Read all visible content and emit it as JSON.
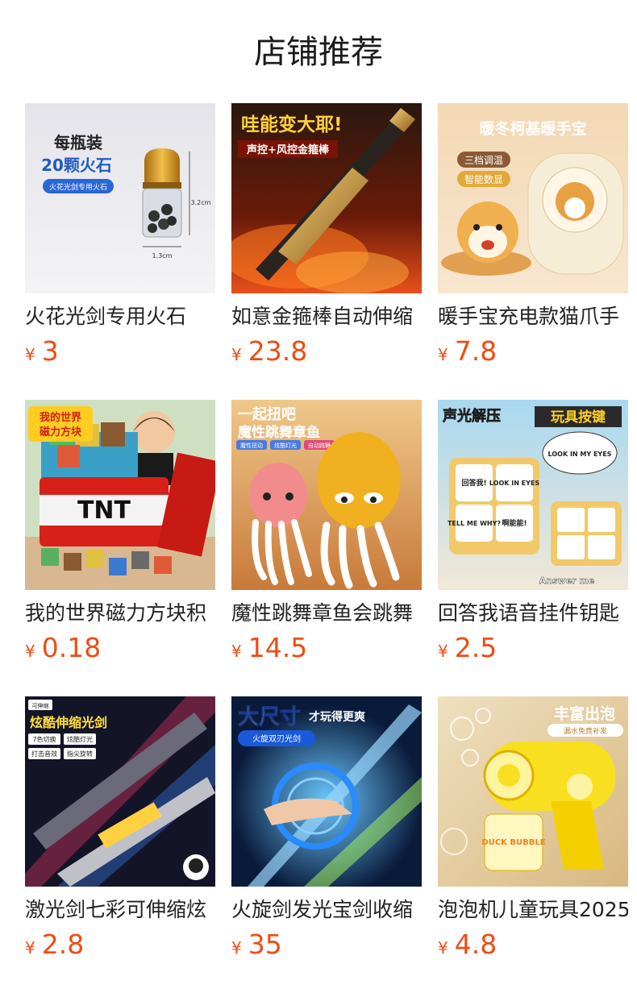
{
  "page": {
    "title": "店铺推荐"
  },
  "products": [
    {
      "name": "火花光剑专用火石",
      "currency": "¥",
      "price": "3",
      "thumb_texts": [
        "每瓶装",
        "20颗火石",
        "火花光剑专用火石",
        "3.2cm",
        "1.3cm"
      ]
    },
    {
      "name": "如意金箍棒自动伸缩",
      "currency": "¥",
      "price": "23.8",
      "thumb_texts": [
        "哇能变大耶!",
        "声控+风控金箍棒"
      ]
    },
    {
      "name": "暖手宝充电款猫爪手",
      "currency": "¥",
      "price": "7.8",
      "thumb_texts": [
        "暖冬柯基暖手宝",
        "三档调温",
        "智能数显"
      ]
    },
    {
      "name": "我的世界磁力方块积",
      "currency": "¥",
      "price": "0.18",
      "thumb_texts": [
        "我的世界",
        "磁力方块",
        "TNT"
      ]
    },
    {
      "name": "魔性跳舞章鱼会跳舞",
      "currency": "¥",
      "price": "14.5",
      "thumb_texts": [
        "一起扭吧",
        "魔性跳舞章鱼",
        "魔性扭动",
        "炫酷灯光",
        "自动跳舞"
      ]
    },
    {
      "name": "回答我语音挂件钥匙",
      "currency": "¥",
      "price": "2.5",
      "thumb_texts": [
        "声光解压",
        "玩具按键",
        "LOOK IN MY EYES",
        "回答我!",
        "LOOK IN EYES",
        "TELL ME WHY?",
        "啊能能!",
        "Answer me"
      ]
    },
    {
      "name": "激光剑七彩可伸缩炫",
      "currency": "¥",
      "price": "2.8",
      "thumb_texts": [
        "可伸缩",
        "炫酷伸缩光剑",
        "7色切换",
        "炫酷灯光",
        "打击音效",
        "指尖旋转"
      ]
    },
    {
      "name": "火旋剑发光宝剑收缩",
      "currency": "¥",
      "price": "35",
      "thumb_texts": [
        "大尺寸",
        "才玩得更爽",
        "火旋双刃光剑"
      ]
    },
    {
      "name": "泡泡机儿童玩具2025",
      "currency": "¥",
      "price": "4.8",
      "thumb_texts": [
        "丰富出泡",
        "漏水免费补发",
        "DUCK BUBBLE"
      ]
    }
  ],
  "colors": {
    "price": "#ee4d14",
    "title": "#1a1a1a"
  }
}
